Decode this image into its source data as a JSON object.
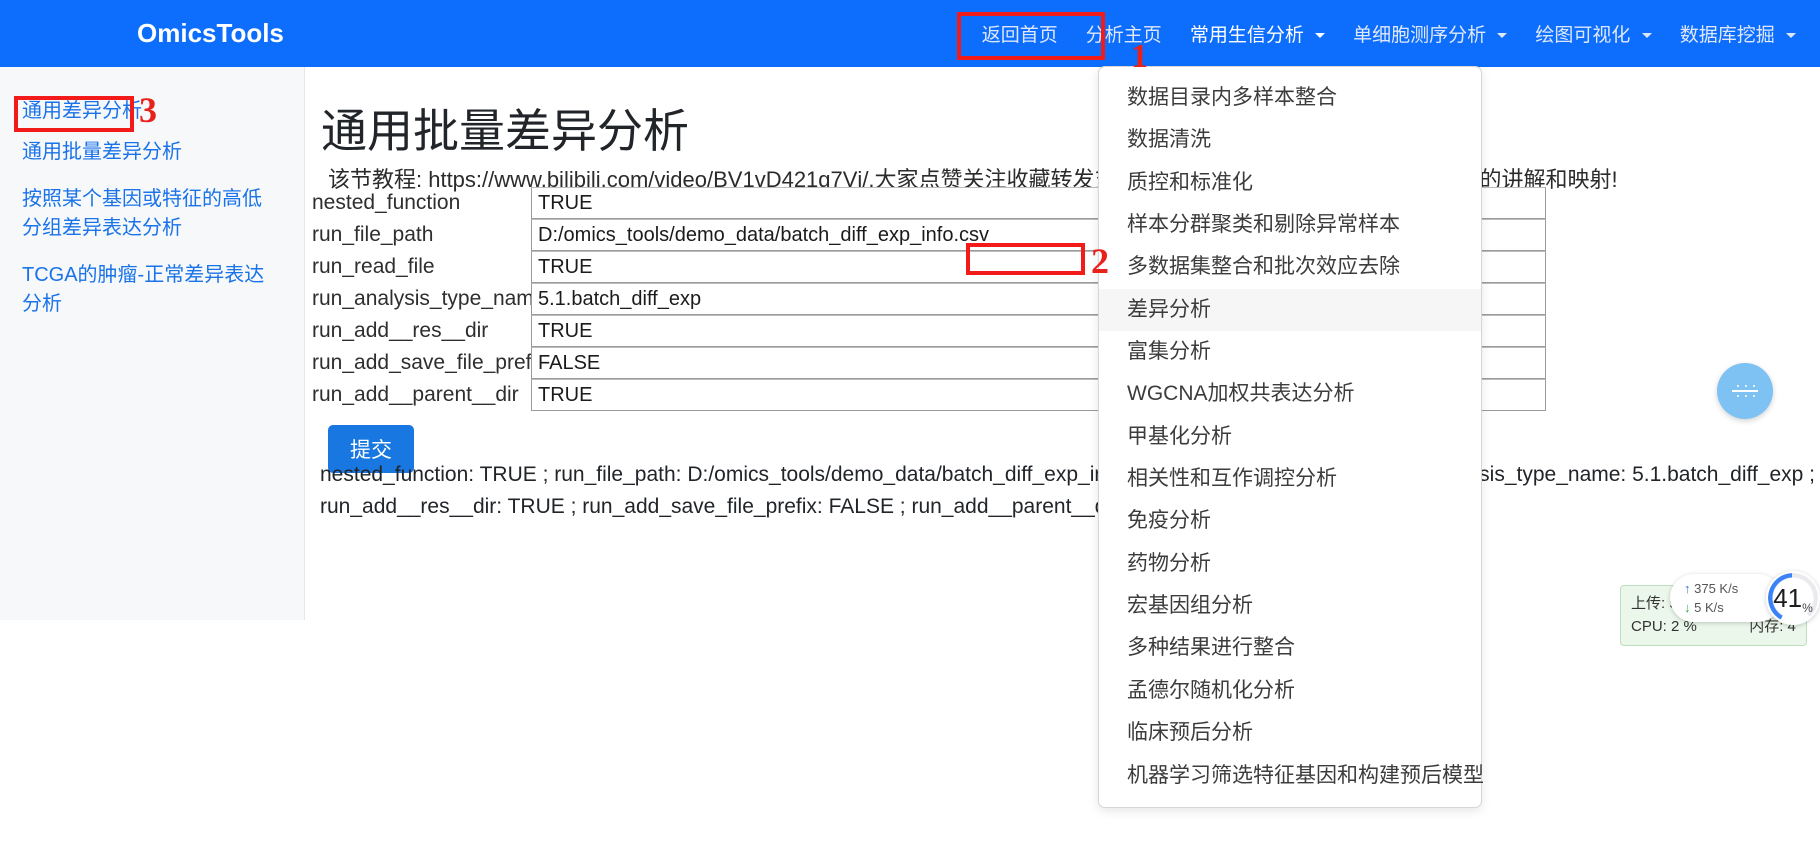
{
  "navbar": {
    "brand": "OmicsTools",
    "links": [
      {
        "label": "返回首页",
        "name": "nav-home",
        "caret": false
      },
      {
        "label": "分析主页",
        "name": "nav-analysis-home",
        "caret": false
      },
      {
        "label": "常用生信分析",
        "name": "nav-common-bioinfo",
        "caret": true
      },
      {
        "label": "单细胞测序分析",
        "name": "nav-single-cell",
        "caret": true
      },
      {
        "label": "绘图可视化",
        "name": "nav-plot-viz",
        "caret": true
      },
      {
        "label": "数据库挖掘",
        "name": "nav-database-mining",
        "caret": true
      }
    ],
    "accent_color": "#0d6efd"
  },
  "dropdown": {
    "items": [
      "数据目录内多样本整合",
      "数据清洗",
      "质控和标准化",
      "样本分群聚类和剔除异常样本",
      "多数据集整合和批次效应去除",
      "差异分析",
      "富集分析",
      "WGCNA加权共表达分析",
      "甲基化分析",
      "相关性和互作调控分析",
      "免疫分析",
      "药物分析",
      "宏基因组分析",
      "多种结果进行整合",
      "孟德尔随机化分析",
      "临床预后分析",
      "机器学习筛选特征基因和构建预后模型"
    ],
    "highlighted_index": 5
  },
  "annotations": [
    {
      "label": "1",
      "name": "annotation-marker-1"
    },
    {
      "label": "2",
      "name": "annotation-marker-2"
    },
    {
      "label": "3",
      "name": "annotation-marker-3"
    }
  ],
  "sidebar": {
    "items": [
      "通用差异分析",
      "通用批量差异分析",
      "按照某个基因或特征的高低分组差异表达分析",
      "TCGA的肿瘤-正常差异表达分析"
    ]
  },
  "main": {
    "title": "通用批量差异分析",
    "subtitle": "该节教程: https://www.bilibili.com/video/BV1vD421g7Vj/,大家点赞关注收藏转发支持一下,谢谢!原视频请看B站,有更详细的讲解和映射!",
    "submit_label": "提交",
    "fields": [
      {
        "label": "nested_function",
        "value": "TRUE",
        "name": "field-nested-function"
      },
      {
        "label": "run_file_path",
        "value": "D:/omics_tools/demo_data/batch_diff_exp_info.csv",
        "name": "field-run-file-path"
      },
      {
        "label": "run_read_file",
        "value": "TRUE",
        "name": "field-run-read-file"
      },
      {
        "label": "run_analysis_type_name",
        "value": "5.1.batch_diff_exp",
        "name": "field-run-analysis-type-name"
      },
      {
        "label": "run_add__res__dir",
        "value": "TRUE",
        "name": "field-run-add-res-dir"
      },
      {
        "label": "run_add_save_file_prefix",
        "value": "FALSE",
        "name": "field-run-add-save-file-prefix"
      },
      {
        "label": "run_add__parent__dir",
        "value": "TRUE",
        "name": "field-run-add-parent-dir"
      }
    ],
    "echo_line_1": "nested_function: TRUE ; run_file_path: D:/omics_tools/demo_data/batch_diff_exp_info.csv ; run_read_file: TRUE ; run_analysis_type_name: 5.1.batch_diff_exp ;",
    "echo_line_2": "run_add__res__dir: TRUE ; run_add_save_file_prefix: FALSE ; run_add__parent__dir: TRUE ;"
  },
  "widgets": {
    "netmon": {
      "upload": "375 K/s",
      "download": "5   K/s",
      "gauge_value": "41",
      "gauge_unit": "%"
    },
    "statusbox": {
      "line1": "上传: 579.5 KB/s 下载: 5",
      "line2_left": "CPU: 2 %",
      "line2_right": "内存: 4"
    }
  }
}
